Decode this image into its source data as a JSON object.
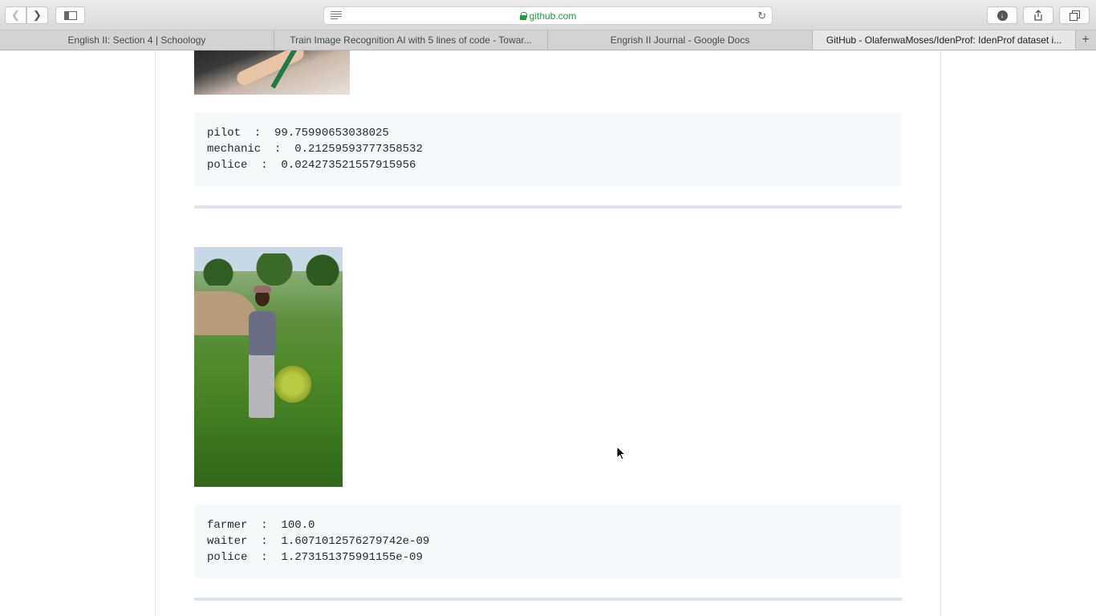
{
  "browser": {
    "url_host": "github.com",
    "tabs": [
      {
        "label": "English II: Section 4 | Schoology",
        "active": false
      },
      {
        "label": "Train Image Recognition AI with 5 lines of code - Towar...",
        "active": false
      },
      {
        "label": "Engrish II Journal - Google Docs",
        "active": false
      },
      {
        "label": "GitHub - OlafenwaMoses/IdenProf: IdenProf dataset i...",
        "active": true
      }
    ]
  },
  "page": {
    "result1": {
      "lines": [
        "pilot  :  99.75990653038025",
        "mechanic  :  0.21259593777358532",
        "police  :  0.024273521557915956"
      ]
    },
    "result2": {
      "lines": [
        "farmer  :  100.0",
        "waiter  :  1.6071012576279742e-09",
        "police  :  1.273151375991155e-09"
      ]
    }
  }
}
